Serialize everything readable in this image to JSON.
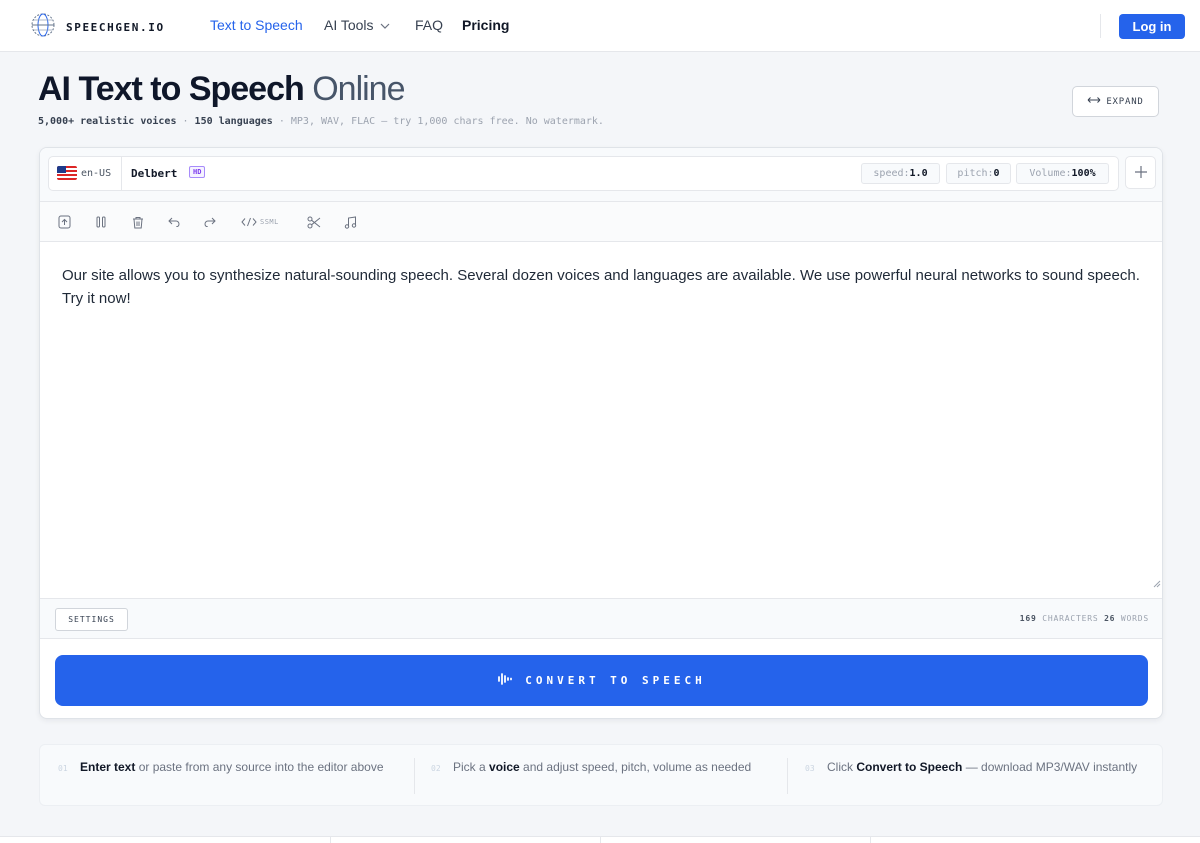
{
  "nav": {
    "brand": "SPEECHGEN.IO",
    "links": [
      "Text to Speech",
      "AI Tools",
      "FAQ",
      "Pricing"
    ],
    "login": "Log in"
  },
  "hero": {
    "title_bold": "AI Text to Speech",
    "title_light": "Online",
    "sub_voices": "5,000+ realistic voices",
    "sub_sep1": " · ",
    "sub_langs": "150 languages",
    "sub_rest": " · MP3, WAV, FLAC — try 1,000 chars free. No watermark.",
    "expand": "EXPAND"
  },
  "voice": {
    "lang": "en-US",
    "name": "Delbert",
    "badge": "HD",
    "speed_label": "speed:",
    "speed_value": "1.0",
    "pitch_label": "pitch:",
    "pitch_value": "0",
    "volume_label": "Volume:",
    "volume_value": "100%"
  },
  "toolbar": {
    "ssml": "SSML",
    "icons": [
      "upload-icon",
      "pause-icon",
      "trash-icon",
      "undo-icon",
      "redo-icon",
      "code-icon",
      "scissors-icon",
      "music-icon"
    ]
  },
  "editor": {
    "text": "Our site allows you to synthesize natural-sounding speech. Several dozen voices and languages are available. We use powerful neural networks to sound speech. Try it now!"
  },
  "footer": {
    "settings": "SETTINGS",
    "char_count": "169",
    "char_label": " CHARACTERS ",
    "word_count": "26",
    "word_label": " WORDS"
  },
  "convert": {
    "label": "CONVERT TO SPEECH"
  },
  "steps": [
    {
      "num": "01",
      "bold": "Enter text",
      "rest": " or paste from any source into the editor above"
    },
    {
      "num": "02",
      "pre": "Pick a ",
      "bold": "voice",
      "rest": " and adjust speed, pitch, volume as needed"
    },
    {
      "num": "03",
      "pre": "Click ",
      "bold": "Convert to Speech",
      "rest": " — download MP3/WAV instantly"
    }
  ],
  "colors": {
    "accent": "#2563eb",
    "badge": "#7c3aed"
  }
}
